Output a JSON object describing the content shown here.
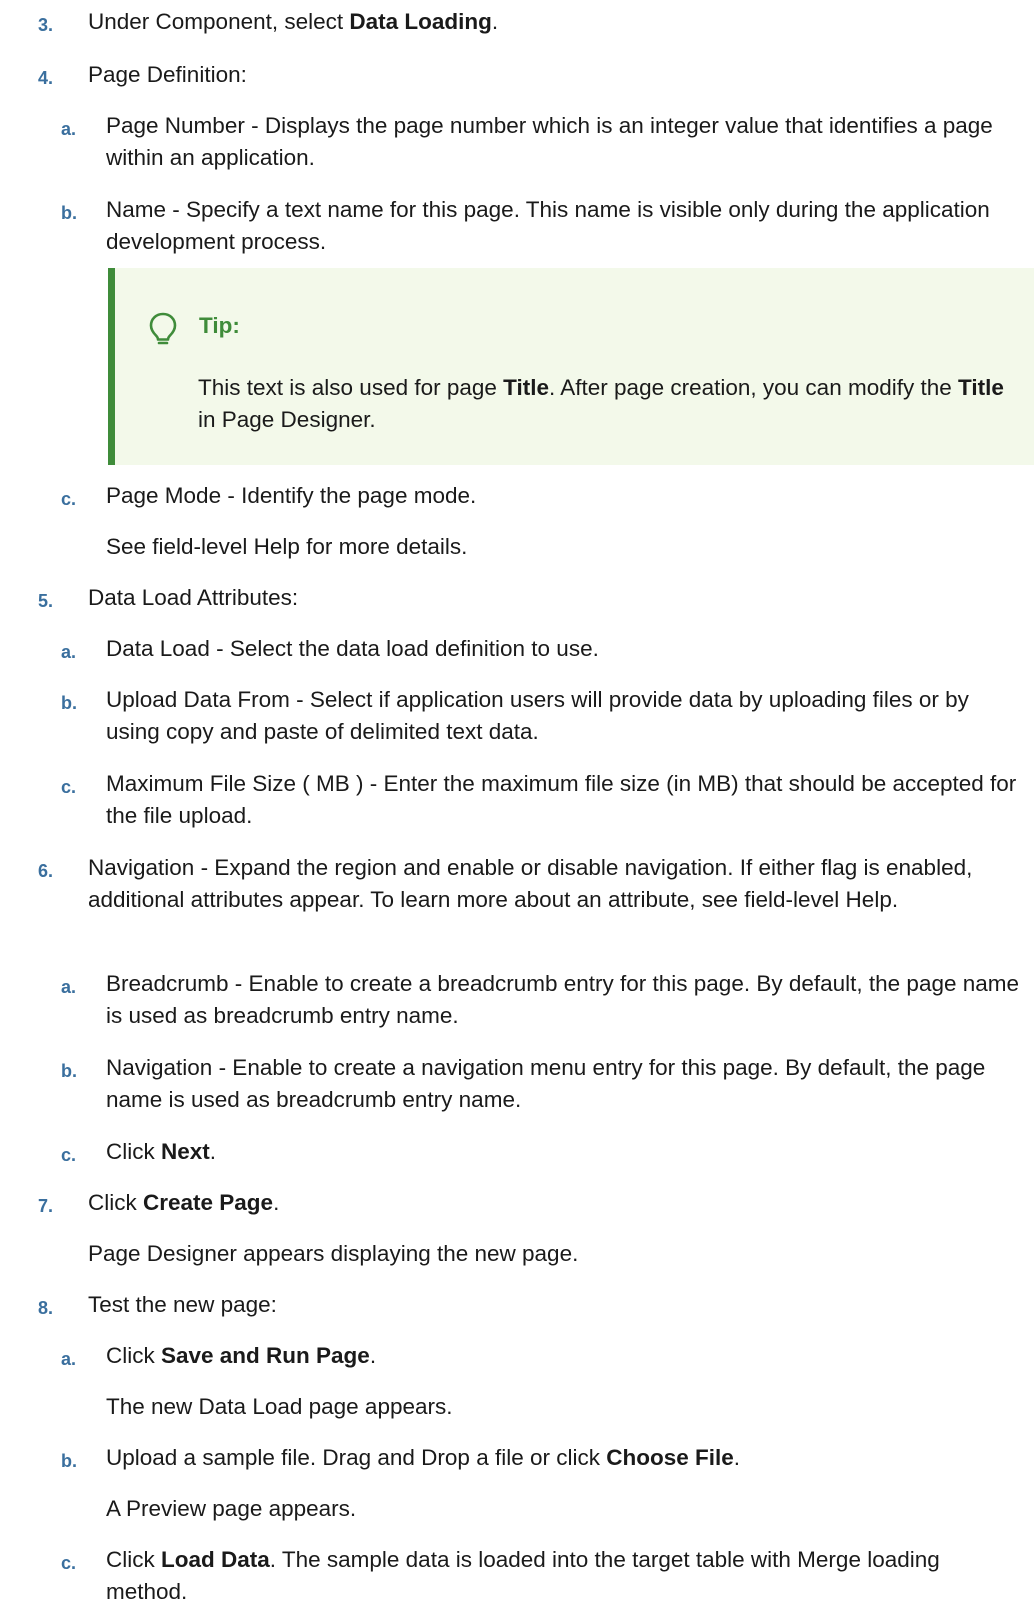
{
  "steps": {
    "s3": {
      "num": "3.",
      "pre": "Under Component, select ",
      "bold": "Data Loading",
      "post": "."
    },
    "s4": {
      "num": "4.",
      "text": "Page Definition:",
      "a": {
        "label": "a.",
        "text": "Page Number - Displays the page number which is an integer value that identifies a page within an application."
      },
      "b": {
        "label": "b.",
        "text": "Name - Specify a text name for this page. This name is visible only during the application development process."
      },
      "tip": {
        "title": "Tip:",
        "pre1": "This text is also used for page ",
        "bold1": "Title",
        "mid": ". After page creation, you can modify the ",
        "bold2": "Title",
        "post": " in Page Designer.",
        "icon": "lightbulb-icon"
      },
      "c": {
        "label": "c.",
        "text": "Page Mode - Identify the page mode.",
        "note": "See field-level Help for more details."
      }
    },
    "s5": {
      "num": "5.",
      "text": "Data Load Attributes:",
      "a": {
        "label": "a.",
        "text": "Data Load - Select the data load definition to use."
      },
      "b": {
        "label": "b.",
        "text": "Upload Data From - Select if application users will provide data by uploading files or by using copy and paste of delimited text data."
      },
      "c": {
        "label": "c.",
        "text": "Maximum File Size ( MB ) - Enter the maximum file size (in MB) that should be accepted for the file upload."
      }
    },
    "s6": {
      "num": "6.",
      "text": "Navigation - Expand the region and enable or disable navigation. If either flag is enabled, additional attributes appear. To learn more about an attribute, see field-level Help.",
      "a": {
        "label": "a.",
        "text": "Breadcrumb - Enable to create a breadcrumb entry for this page. By default, the page name is used as breadcrumb entry name."
      },
      "b": {
        "label": "b.",
        "text": "Navigation - Enable to create a navigation menu entry for this page. By default, the page name is used as breadcrumb entry name."
      },
      "c": {
        "label": "c.",
        "pre": "Click ",
        "bold": "Next",
        "post": "."
      }
    },
    "s7": {
      "num": "7.",
      "pre": "Click ",
      "bold": "Create Page",
      "post": ".",
      "note": "Page Designer appears displaying the new page."
    },
    "s8": {
      "num": "8.",
      "text": "Test the new page:",
      "a": {
        "label": "a.",
        "pre": "Click ",
        "bold": "Save and Run Page",
        "post": ".",
        "note": "The new Data Load page appears."
      },
      "b": {
        "label": "b.",
        "pre": "Upload a sample file. Drag and Drop a file or click ",
        "bold": "Choose File",
        "post": ".",
        "note": "A Preview page appears."
      },
      "c": {
        "label": "c.",
        "pre": "Click ",
        "bold": "Load Data",
        "post": ". The sample data is loaded into the target table with Merge loading method."
      }
    }
  },
  "colors": {
    "number": "#3a6f9e",
    "tip_accent": "#3f8c3a",
    "tip_bg": "#f3f9ea"
  }
}
